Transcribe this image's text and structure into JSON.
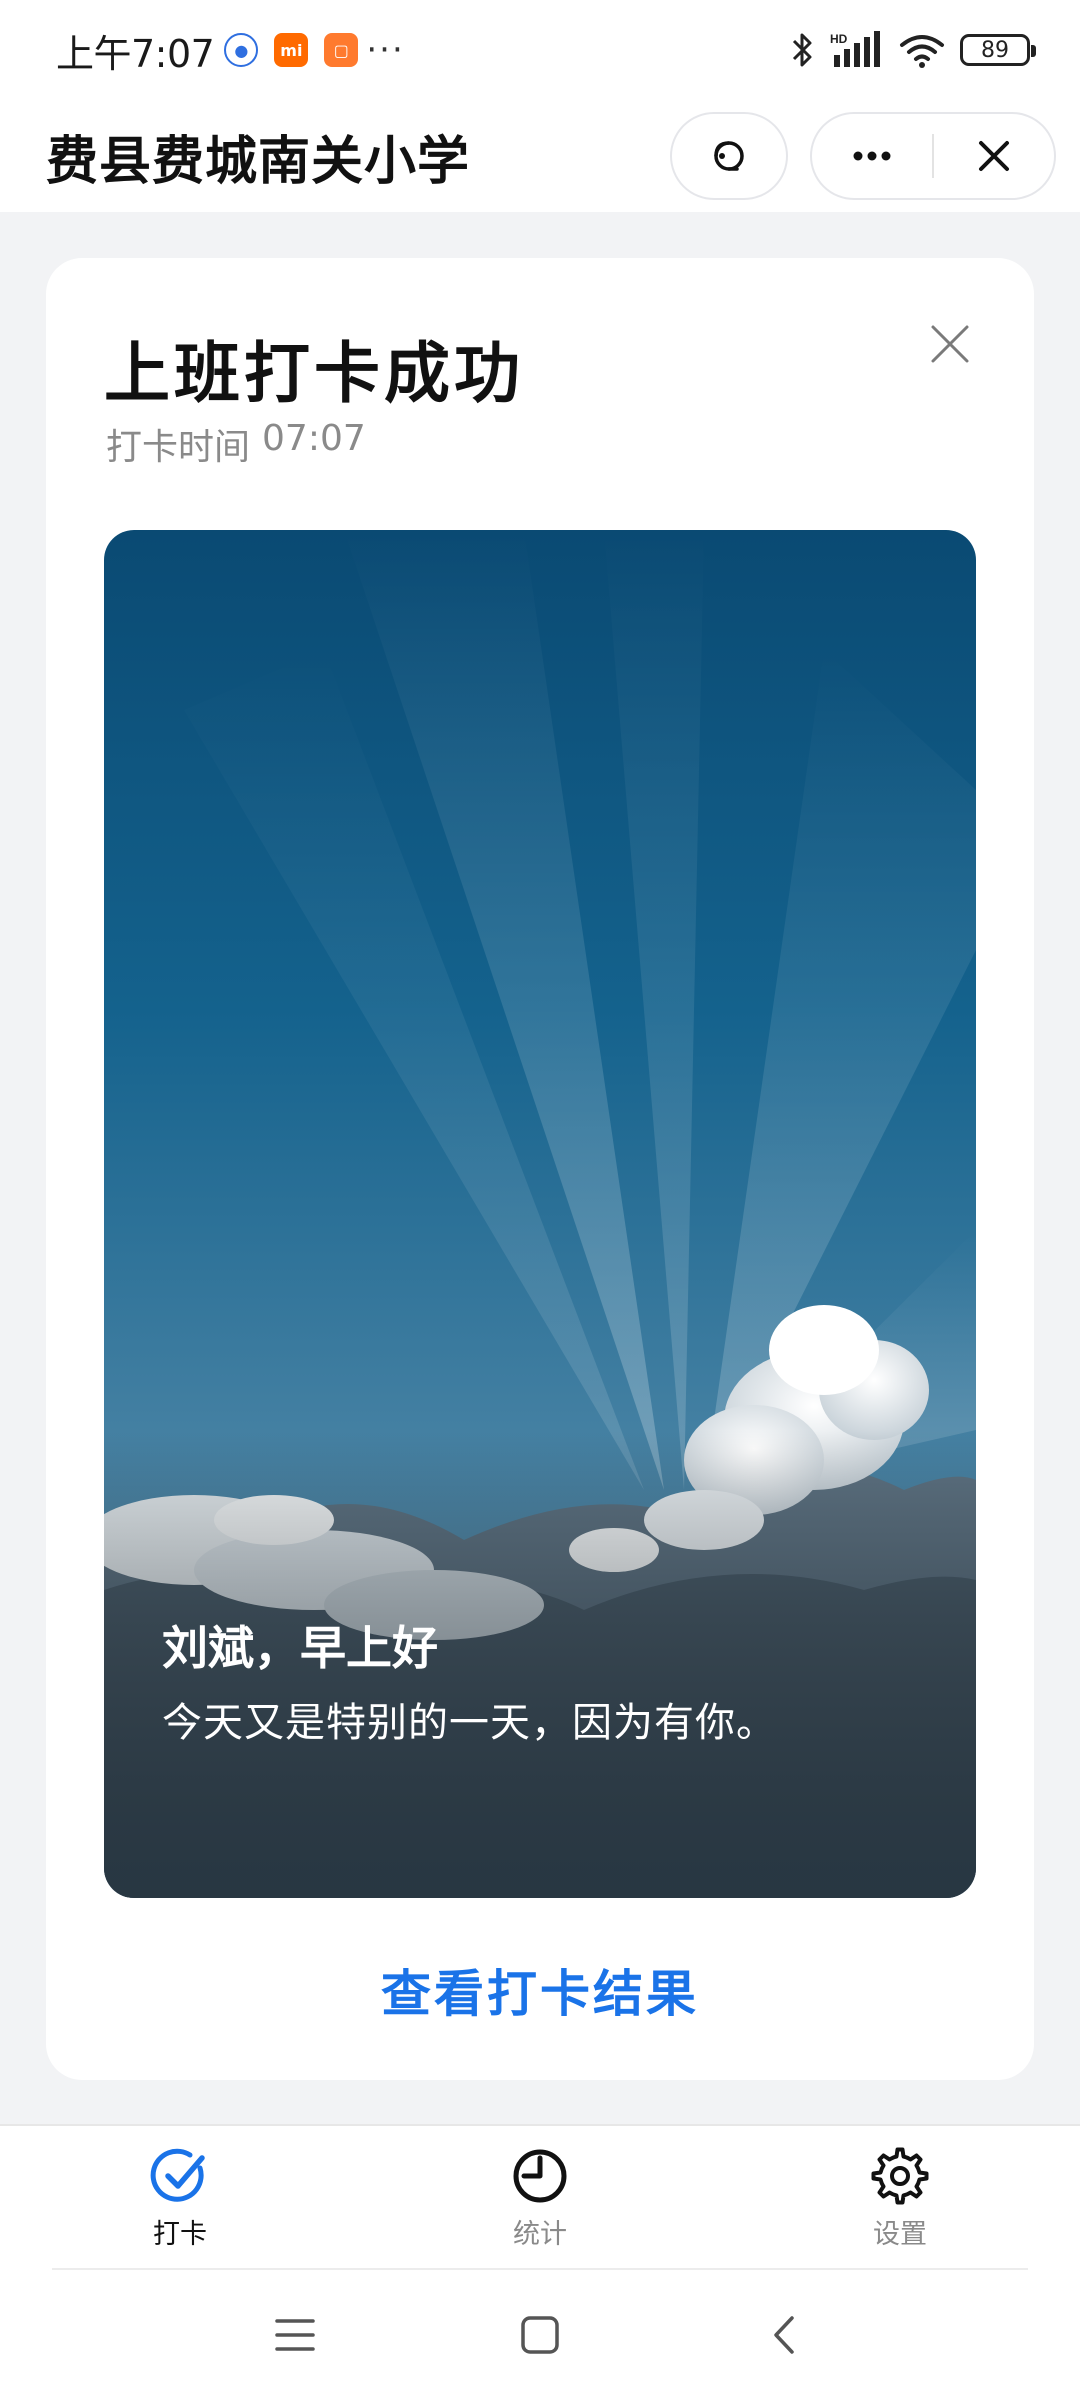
{
  "status_bar": {
    "time": "上午7:07",
    "notification_icons": [
      "baidu-app-icon",
      "mi-app-icon",
      "mi-shop-icon"
    ],
    "more": "···",
    "battery": "89"
  },
  "title_bar": {
    "title": "费县费城南关小学",
    "actions": [
      "customer-service-icon",
      "more-icon",
      "close-icon"
    ]
  },
  "card": {
    "heading": "上班打卡成功",
    "punch_time_label": "打卡时间",
    "punch_time_value": "07:07",
    "greeting": "刘斌，早上好",
    "motto": "今天又是特别的一天，因为有你。",
    "view_result_link": "查看打卡结果"
  },
  "tabs": [
    {
      "label": "打卡",
      "icon": "check-circle-icon",
      "active": true
    },
    {
      "label": "统计",
      "icon": "pie-chart-icon",
      "active": false
    },
    {
      "label": "设置",
      "icon": "gear-icon",
      "active": false
    }
  ],
  "colors": {
    "accent": "#1a73e8",
    "background": "#f2f3f5",
    "sky_top": "#0b4a72",
    "sky_bottom": "#6f9bb3"
  }
}
